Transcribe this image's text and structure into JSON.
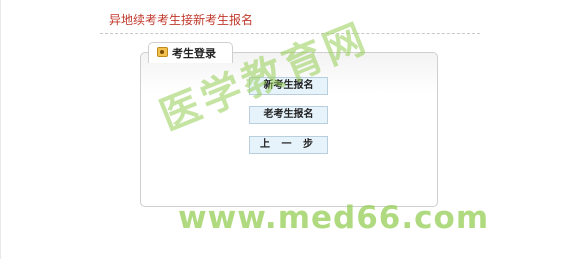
{
  "header": {
    "title": "异地续考考生接新考生报名"
  },
  "panel": {
    "tab_label": "考生登录",
    "tab_icon": "user-card-icon",
    "buttons": {
      "new_label": "新考生报名",
      "old_label": "老考生报名",
      "prev_label": "上 一 步"
    }
  },
  "watermark": {
    "cn_text": "医学教育网",
    "url_text": "www.med66.com"
  },
  "colors": {
    "header_text": "#c0392b",
    "button_bg": "#e7f3fb",
    "button_border": "#b9cfdd",
    "watermark": "#96cd55"
  }
}
